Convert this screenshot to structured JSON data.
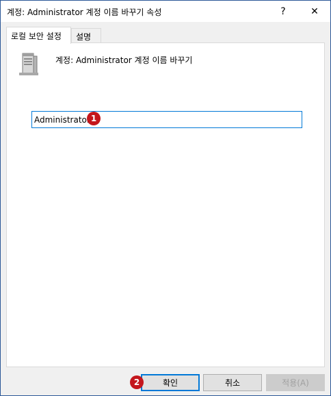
{
  "window": {
    "title": "계정: Administrator 계정 이름 바꾸기 속성",
    "help_label": "?",
    "close_label": "✕"
  },
  "tabs": [
    {
      "label": "로컬 보안 설정",
      "active": true
    },
    {
      "label": "설명",
      "active": false
    }
  ],
  "panel": {
    "heading": "계정: Administrator 계정 이름 바꾸기",
    "icon": "server-icon",
    "input_value": "Administrator"
  },
  "markers": [
    "1",
    "2"
  ],
  "buttons": {
    "ok_label": "확인",
    "cancel_label": "취소",
    "apply_label": "적용(A)"
  },
  "colors": {
    "accent": "#0078d7",
    "marker": "#c4161c",
    "disabled_text": "#a0a0a0"
  }
}
